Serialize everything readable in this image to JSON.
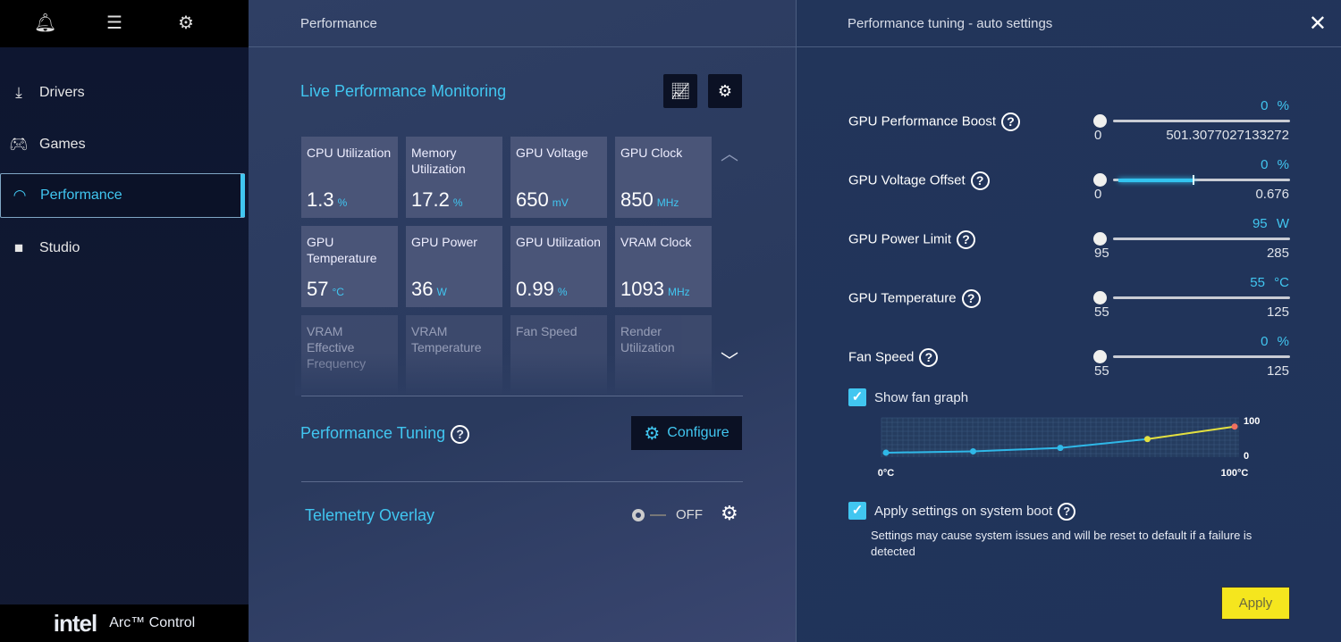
{
  "sidebar": {
    "top_icons": [
      "bell-icon",
      "menu-icon",
      "gear-icon"
    ],
    "items": [
      {
        "label": "Drivers",
        "icon": "download-icon"
      },
      {
        "label": "Games",
        "icon": "gamepad-icon"
      },
      {
        "label": "Performance",
        "icon": "gauge-icon",
        "active": true
      },
      {
        "label": "Studio",
        "icon": "camera-icon"
      }
    ],
    "brand": {
      "logo": "intel",
      "product": "Arc™ Control"
    }
  },
  "main": {
    "header": "Performance",
    "live": {
      "title": "Live Performance Monitoring",
      "tiles": [
        {
          "label": "CPU Utilization",
          "value": "1.3",
          "unit": "%"
        },
        {
          "label": "Memory Utilization",
          "value": "17.2",
          "unit": "%"
        },
        {
          "label": "GPU Voltage",
          "value": "650",
          "unit": "mV"
        },
        {
          "label": "GPU Clock",
          "value": "850",
          "unit": "MHz"
        },
        {
          "label": "GPU Temperature",
          "value": "57",
          "unit": "°C"
        },
        {
          "label": "GPU Power",
          "value": "36",
          "unit": "W"
        },
        {
          "label": "GPU Utilization",
          "value": "0.99",
          "unit": "%"
        },
        {
          "label": "VRAM Clock",
          "value": "1093",
          "unit": "MHz"
        },
        {
          "label": "VRAM Effective Frequency"
        },
        {
          "label": "VRAM Temperature"
        },
        {
          "label": "Fan Speed"
        },
        {
          "label": "Render Utilization"
        }
      ]
    },
    "tuning": {
      "title": "Performance Tuning",
      "configure": "Configure"
    },
    "telemetry": {
      "title": "Telemetry Overlay",
      "state": "OFF"
    }
  },
  "panel": {
    "title": "Performance tuning - auto settings",
    "sliders": [
      {
        "label": "GPU Performance Boost",
        "value": "0",
        "unit": "%",
        "min": "0",
        "max": "501.3077027133272"
      },
      {
        "label": "GPU Voltage Offset",
        "value": "0",
        "unit": "%",
        "min": "0",
        "max": "0.676"
      },
      {
        "label": "GPU Power Limit",
        "value": "95",
        "unit": "W",
        "min": "95",
        "max": "285"
      },
      {
        "label": "GPU Temperature",
        "value": "55",
        "unit": "°C",
        "min": "55",
        "max": "125"
      },
      {
        "label": "Fan Speed",
        "value": "0",
        "unit": "%",
        "min": "55",
        "max": "125"
      }
    ],
    "show_fan_graph": {
      "label": "Show fan graph",
      "checked": true
    },
    "apply_on_boot": {
      "label": "Apply settings on system boot",
      "checked": true,
      "warning": "Settings may cause system issues and will be reset to default if a failure is detected"
    },
    "apply": "Apply"
  },
  "chart_data": {
    "type": "line",
    "x": [
      0,
      25,
      50,
      75,
      100
    ],
    "y": [
      8,
      12,
      22,
      48,
      85
    ],
    "x_tick_labels": [
      "0°C",
      "100°C"
    ],
    "y_tick_labels": [
      "100",
      "0"
    ],
    "xlim": [
      0,
      100
    ],
    "ylim": [
      0,
      100
    ],
    "grid": true,
    "colors": {
      "low": "#2fb8e8",
      "high": "#e3e040",
      "max_point": "#f07060"
    }
  },
  "colors": {
    "accent": "#41c6f0",
    "apply": "#f5e61e"
  }
}
